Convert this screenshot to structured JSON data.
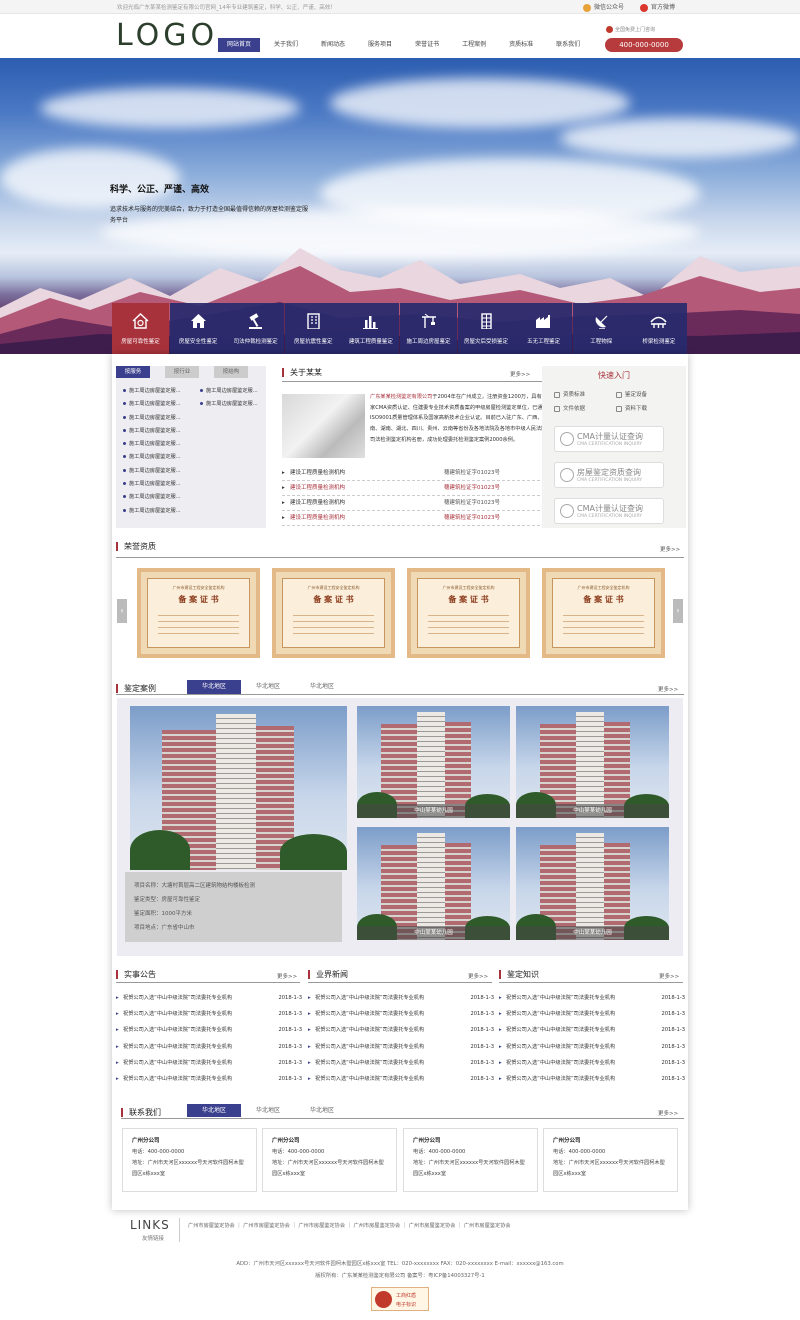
{
  "topbar": {
    "tip": "欢迎光临广东某某检测鉴定有限公司官网_14年专业建筑鉴定，科学、公正、严谨、高效！",
    "wechat": "微信公众号",
    "weibo": "官方微博"
  },
  "header": {
    "logo": "LOGO",
    "nav": [
      "网站首页",
      "关于我们",
      "新闻动态",
      "服务项目",
      "荣誉证书",
      "工程案例",
      "资质标准",
      "联系我们"
    ],
    "tel_tip": "全国免费上门咨询",
    "tel": "400-000-0000"
  },
  "banner": {
    "slogan": "科学、公正、严谨、高效",
    "sub": "追求技术与服务的完美结合，致力于打造全国最值得信赖的房屋检测鉴定服务平台"
  },
  "services": [
    {
      "label": "房屋可靠性鉴定",
      "icon": "house-gear-icon"
    },
    {
      "label": "房屋安全性鉴定",
      "icon": "house-icon"
    },
    {
      "label": "司法仲裁检测鉴定",
      "icon": "gavel-icon"
    },
    {
      "label": "房屋抗震性鉴定",
      "icon": "building-icon"
    },
    {
      "label": "建筑工程质量鉴定",
      "icon": "bar-chart-icon"
    },
    {
      "label": "施工周边房屋鉴定",
      "icon": "crane-icon"
    },
    {
      "label": "房屋灾后受损鉴定",
      "icon": "tower-icon"
    },
    {
      "label": "五无工程鉴定",
      "icon": "factory-icon"
    },
    {
      "label": "工程物探",
      "icon": "satellite-icon"
    },
    {
      "label": "桥梁检测鉴定",
      "icon": "bridge-icon"
    }
  ],
  "categories": {
    "tabs": [
      "按服务",
      "按行业",
      "按结构"
    ],
    "col1": [
      "施工周边房屋鉴定服...",
      "施工周边房屋鉴定服...",
      "施工周边房屋鉴定服...",
      "施工周边房屋鉴定服...",
      "施工周边房屋鉴定服...",
      "施工周边房屋鉴定服...",
      "施工周边房屋鉴定服...",
      "施工周边房屋鉴定服...",
      "施工周边房屋鉴定服...",
      "施工周边房屋鉴定服..."
    ],
    "col2": [
      "施工周边房屋鉴定服...",
      "施工周边房屋鉴定服..."
    ]
  },
  "about": {
    "title": "关于某某",
    "more": "更多>>",
    "company": "广东某某检测鉴定有限公司",
    "text": "于2004年在广州成立，注册资金1200万，具有国家CMA资质认证、住建委专业技术资质备案的甲级房屋检测鉴定单位，已通过ISO9001质量管理体系及国家高新技术企业认证。目前已入驻广东、广西、海南、湖南、湖北、四川、贵州、云南等省份及各地法院及各地市中级人民法院司法检测鉴定机构名册，成功处理委托检测鉴定案例2000余例。",
    "list": [
      {
        "t": "建设工程质量检测机构",
        "d": "穗建筑检证字01023号"
      },
      {
        "t": "建设工程质量检测机构",
        "d": "穗建筑检证字01023号"
      },
      {
        "t": "建设工程质量检测机构",
        "d": "穗建筑检证字01023号"
      },
      {
        "t": "建设工程质量检测机构",
        "d": "穗建筑检证字01023号"
      }
    ]
  },
  "quick": {
    "title": "快速入门",
    "links": [
      "资质标准",
      "鉴定设备",
      "文件依据",
      "资料下载"
    ],
    "cards": [
      {
        "main": "CMA计量认证查询",
        "sub": "CMA CERTIFICATION INQUIRY"
      },
      {
        "main": "房屋鉴定资质查询",
        "sub": "CMA CERTIFICATION INQUIRY"
      },
      {
        "main": "CMA计量认证查询",
        "sub": "CMA CERTIFICATION INQUIRY"
      }
    ]
  },
  "honor": {
    "title": "荣誉资质",
    "more": "更多>>",
    "cert_head": "广州市建设工程安全鉴定机构",
    "cert_title": "备 案 证 书"
  },
  "cases": {
    "title": "鉴定案例",
    "tabs": [
      "华北地区",
      "华北地区",
      "华北地区"
    ],
    "more": "更多>>",
    "info": [
      "项目名称：大塘村首层高二区建筑物结构楼板检测",
      "鉴定类型：房屋可靠性鉴定",
      "鉴定面积：1000平方米",
      "项目地点：广东省中山市"
    ],
    "captions": [
      "中山某某幼儿园",
      "中山某某幼儿园",
      "中山某某幼儿园",
      "中山某某幼儿园"
    ]
  },
  "news": [
    {
      "title": "实事公告",
      "more": "更多>>"
    },
    {
      "title": "业界新闻",
      "more": "更多>>"
    },
    {
      "title": "鉴定知识",
      "more": "更多>>"
    }
  ],
  "news_item": {
    "t": "祝贺公司入选“中山中级法院”司法委托专业机构",
    "d": "2018-1-3"
  },
  "contact": {
    "title": "联系我们",
    "tabs": [
      "华北地区",
      "华北地区",
      "华北地区"
    ],
    "more": "更多>>",
    "cards": [
      {
        "name": "广州分公司",
        "tel": "电话：400-000-0000",
        "addr": "地址：广州市天河区xxxxxx号天河软件园柯木塱园区x栋xxx室"
      },
      {
        "name": "广州分公司",
        "tel": "电话：400-000-0000",
        "addr": "地址：广州市天河区xxxxxx号天河软件园柯木塱园区x栋xxx室"
      },
      {
        "name": "广州分公司",
        "tel": "电话：400-000-0000",
        "addr": "地址：广州市天河区xxxxxx号天河软件园柯木塱园区x栋xxx室"
      },
      {
        "name": "广州分公司",
        "tel": "电话：400-000-0000",
        "addr": "地址：广州市天河区xxxxxx号天河软件园柯木塱园区x栋xxx室"
      }
    ]
  },
  "links": {
    "big": "LINKS",
    "small": "友情链接",
    "items": "广州市房屋鉴定协会 ｜ 广州市房屋鉴定协会 ｜ 广州市房屋鉴定协会 ｜ 广州市房屋鉴定协会 ｜ 广州市房屋鉴定协会 ｜ 广州市房屋鉴定协会"
  },
  "footer": {
    "line1": "ADD：广州市天河区xxxxxx号天河软件园柯木塱园区x栋xxx室 TEL：020-xxxxxxxx FAX：020-xxxxxxxx E-mail：xxxxxx@163.com",
    "line2": "版权所有：广东某某检测鉴定有限公司 备案号：粤ICP备14003327号-1",
    "badge1": "工商红盾",
    "badge2": "电子标识"
  },
  "colors": {
    "accent": "#3a3f8e",
    "brand_red": "#a8323c"
  }
}
